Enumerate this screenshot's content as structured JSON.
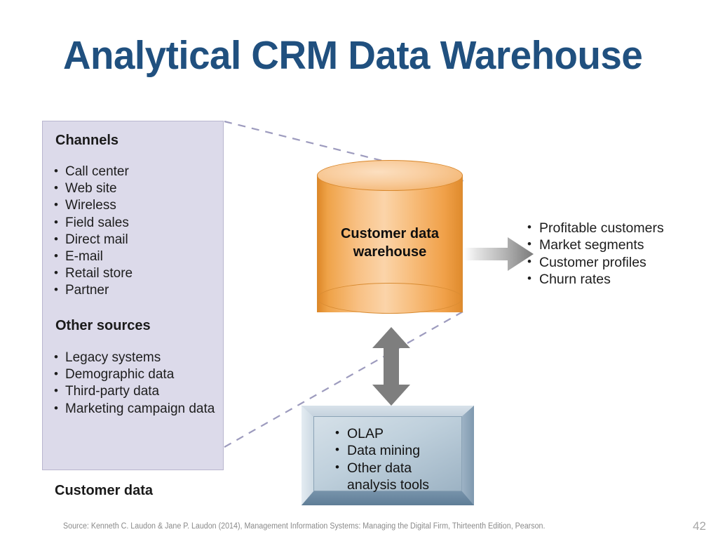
{
  "slide": {
    "title": "Analytical CRM Data Warehouse",
    "title_color": "#20507F",
    "page_number": "42",
    "source_note": "Source: Kenneth C. Laudon & Jane P. Laudon (2014), Management Information Systems: Managing the Digital Firm, Thirteenth Edition, Pearson."
  },
  "diagram": {
    "sources_panel": {
      "caption": "Customer data",
      "fill_color": "#DCDAEA",
      "groups": [
        {
          "heading": "Channels",
          "items": [
            "Call center",
            "Web site",
            "Wireless",
            "Field sales",
            "Direct mail",
            "E-mail",
            "Retail store",
            "Partner"
          ]
        },
        {
          "heading": "Other sources",
          "items": [
            "Legacy systems",
            "Demographic data",
            "Third-party data",
            "Marketing campaign data"
          ]
        }
      ]
    },
    "warehouse": {
      "label_line1": "Customer data",
      "label_line2": "warehouse",
      "fill_color": "#F8C083"
    },
    "outputs": {
      "items": [
        "Profitable customers",
        "Market segments",
        "Customer profiles",
        "Churn rates"
      ]
    },
    "analysis_tools": {
      "fill_color": "#BFD0DC",
      "items": [
        "OLAP",
        "Data mining",
        "Other data",
        "analysis tools"
      ]
    },
    "arrows": {
      "output_arrow": "right-arrow-icon",
      "tools_arrow": "double-headed-vertical-arrow-icon"
    }
  }
}
